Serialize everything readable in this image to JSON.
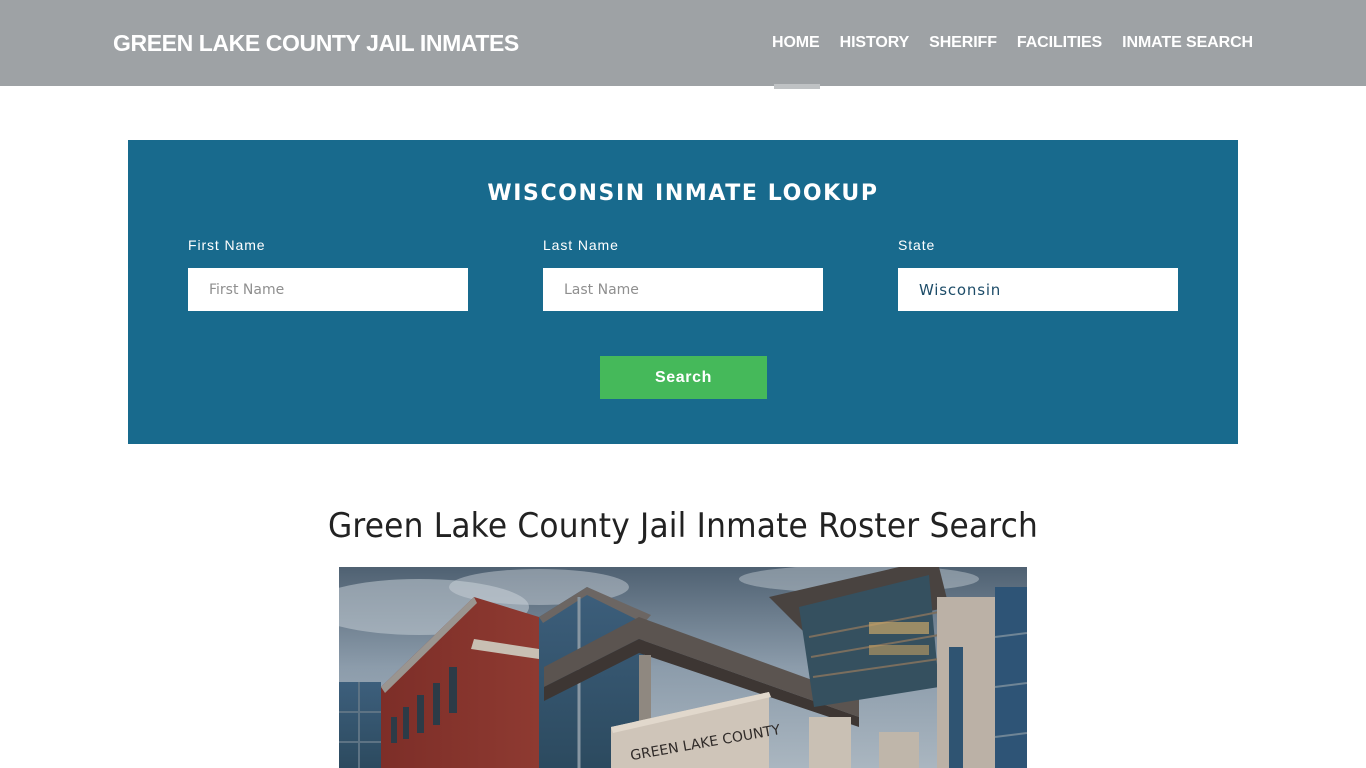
{
  "header": {
    "brand": "GREEN LAKE COUNTY JAIL INMATES",
    "nav": [
      {
        "label": "HOME",
        "active": true
      },
      {
        "label": "HISTORY",
        "active": false
      },
      {
        "label": "SHERIFF",
        "active": false
      },
      {
        "label": "FACILITIES",
        "active": false
      },
      {
        "label": "INMATE SEARCH",
        "active": false
      }
    ]
  },
  "lookup": {
    "title": "WISCONSIN INMATE LOOKUP",
    "fields": {
      "first_name": {
        "label": "First Name",
        "placeholder": "First Name",
        "value": ""
      },
      "last_name": {
        "label": "Last Name",
        "placeholder": "Last Name",
        "value": ""
      },
      "state": {
        "label": "State",
        "value": "Wisconsin"
      }
    },
    "search_label": "Search"
  },
  "main": {
    "title": "Green Lake County Jail Inmate Roster Search",
    "photo": {
      "alt": "Green Lake County building exterior",
      "sign_text": "GREEN LAKE COUNTY"
    }
  },
  "colors": {
    "header_bg": "#9ea2a5",
    "panel_bg": "#186a8d",
    "button_bg": "#45b95a",
    "nav_active_underline": "#bfc2c4"
  }
}
